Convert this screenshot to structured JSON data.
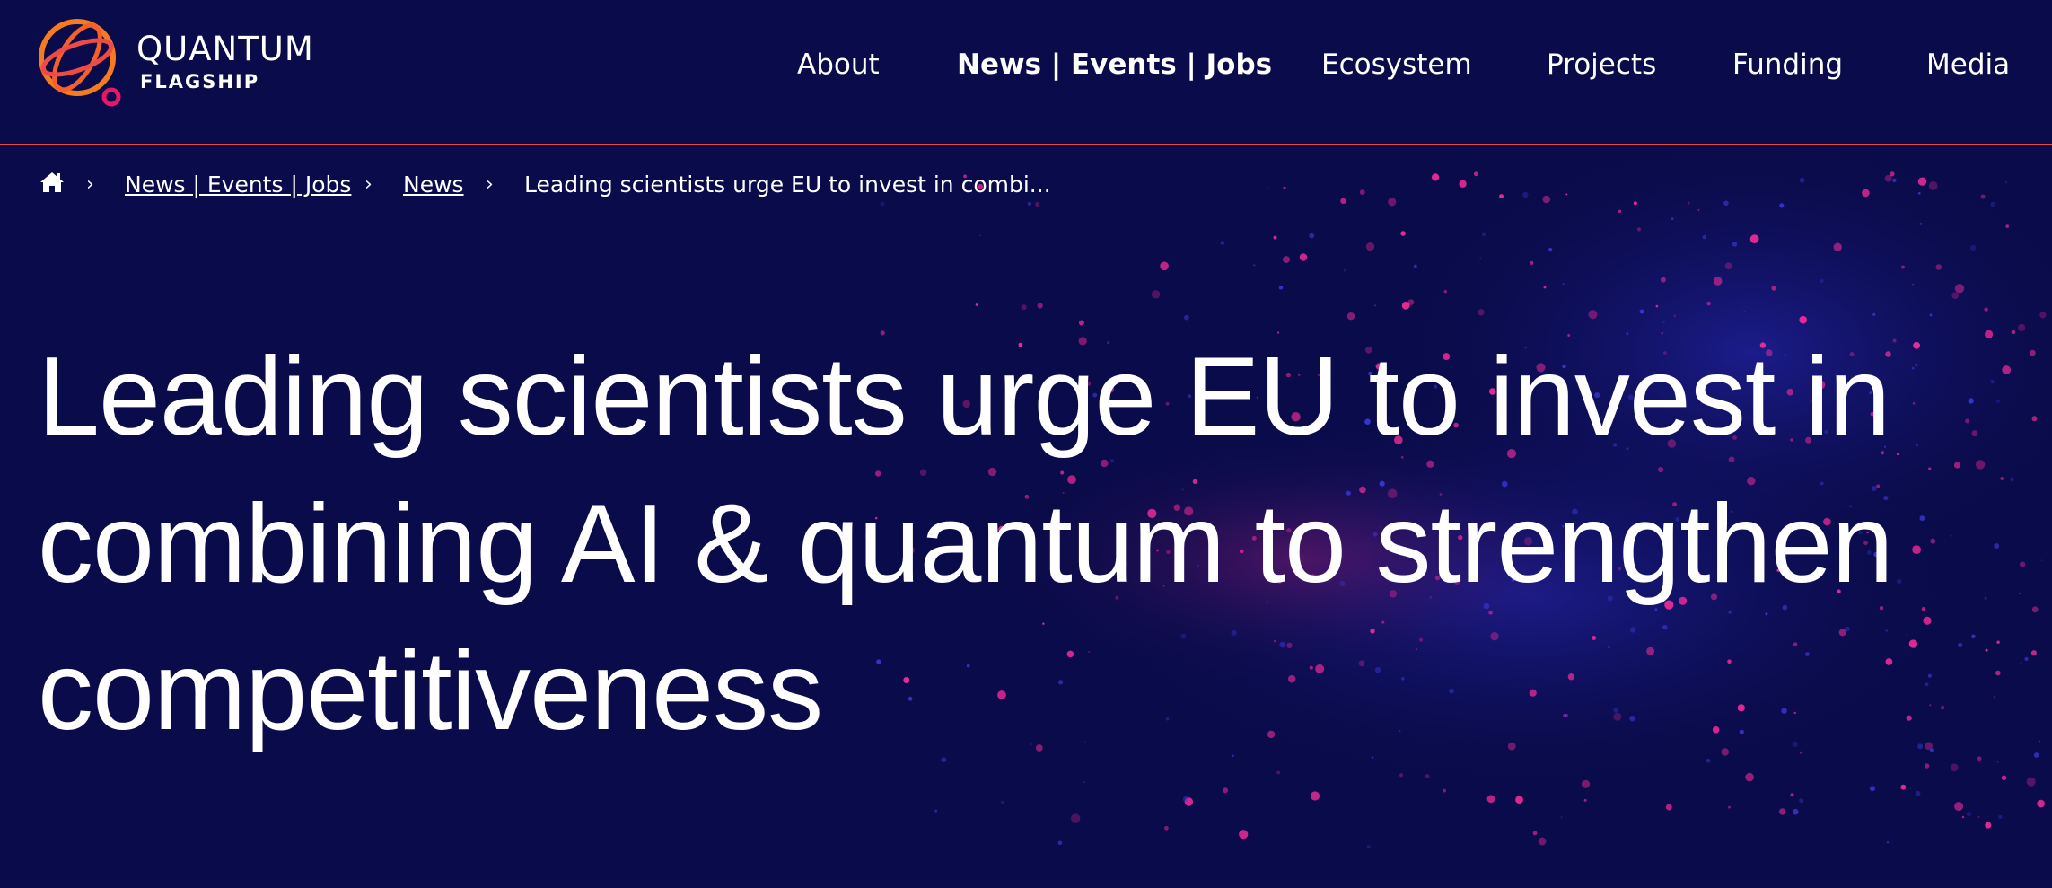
{
  "logo": {
    "word": "QUANTUM",
    "sub": "FLAGSHIP"
  },
  "nav": {
    "items": [
      {
        "label": "About"
      },
      {
        "label": "News | Events | Jobs"
      },
      {
        "label": "Ecosystem"
      },
      {
        "label": "Projects"
      },
      {
        "label": "Funding"
      },
      {
        "label": "Media"
      }
    ],
    "active": "News | Events | Jobs"
  },
  "breadcrumb": {
    "home_icon": "home-icon",
    "separator": "›",
    "items": [
      {
        "label": "News | Events | Jobs"
      },
      {
        "label": "News"
      },
      {
        "label": "Leading scientists urge EU to invest in combi..."
      }
    ]
  },
  "article": {
    "title": "Leading scientists urge EU to invest in combining AI & quantum to strengthen competitiveness"
  },
  "colors": {
    "background": "#0a0b4a",
    "accent_line": "#e8483a",
    "logo_orange": "#f47b20",
    "logo_pink": "#e8176b",
    "particle_pink": "#ff2d9b",
    "particle_blue": "#3a3ad8"
  }
}
